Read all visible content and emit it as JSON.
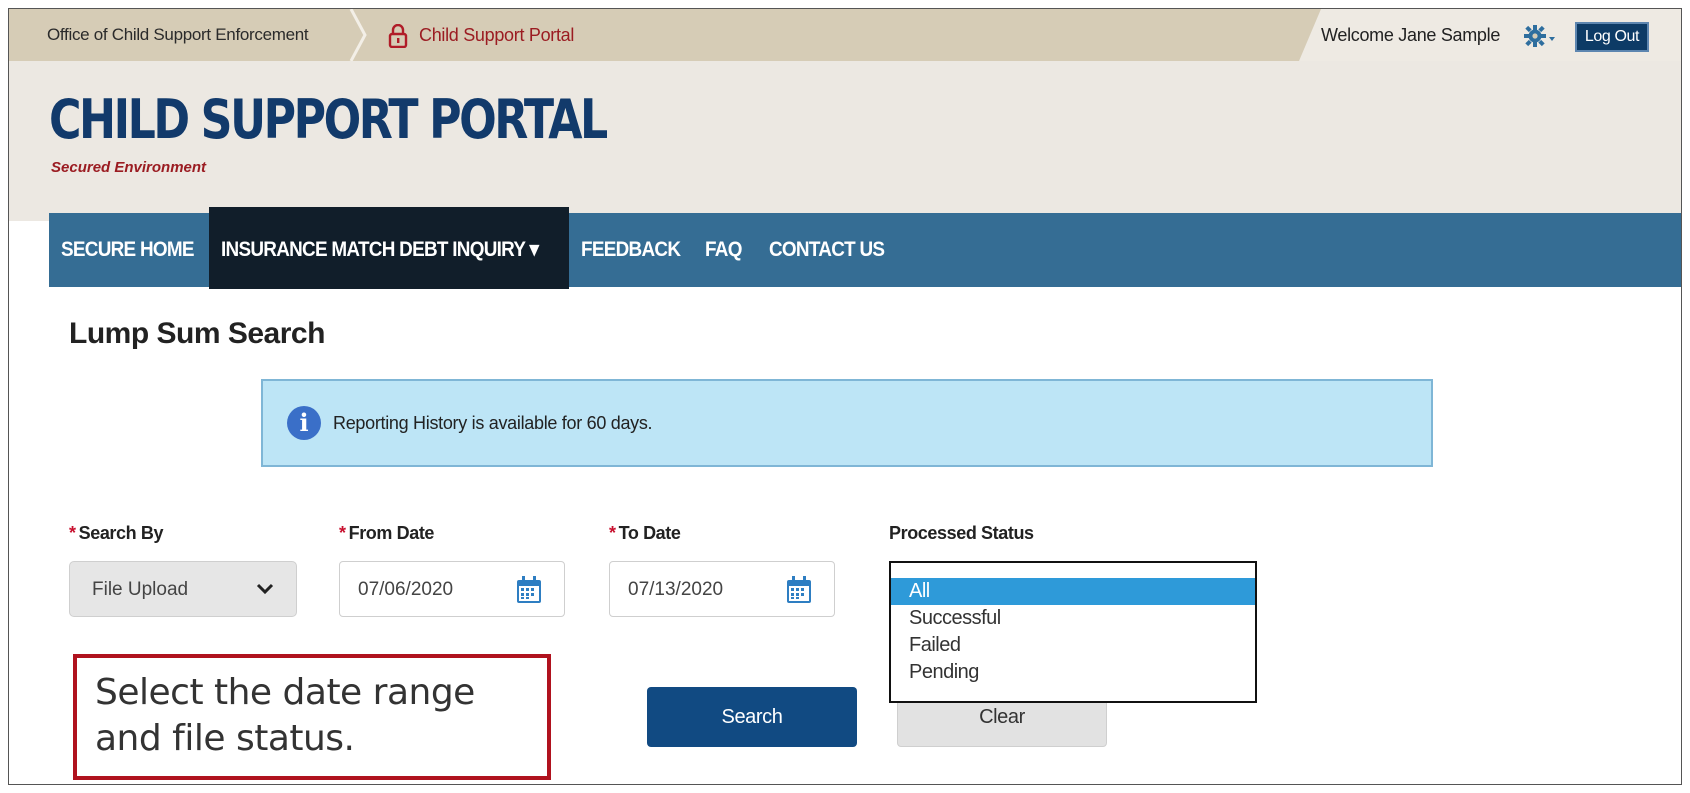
{
  "topbar": {
    "office_label": "Office of Child Support Enforcement",
    "portal_label": "Child Support Portal",
    "welcome_text": "Welcome Jane Sample",
    "logout_label": "Log Out"
  },
  "header": {
    "brand_title": "CHILD SUPPORT PORTAL",
    "brand_subtitle": "Secured Environment"
  },
  "nav": {
    "items": [
      {
        "label": "SECURE HOME"
      },
      {
        "label": "INSURANCE MATCH DEBT INQUIRY ▾"
      },
      {
        "label": "FEEDBACK"
      },
      {
        "label": "FAQ"
      },
      {
        "label": "CONTACT US"
      }
    ],
    "active_index": 1
  },
  "page": {
    "title": "Lump Sum Search",
    "info_text": "Reporting History is available for 60 days."
  },
  "form": {
    "search_by": {
      "label": "Search By",
      "required_mark": "*",
      "value": "File Upload"
    },
    "from_date": {
      "label": "From Date",
      "required_mark": "*",
      "value": "07/06/2020"
    },
    "to_date": {
      "label": "To Date",
      "required_mark": "*",
      "value": "07/13/2020"
    },
    "processed_status": {
      "label": "Processed Status",
      "options": [
        "All",
        "Successful",
        "Failed",
        "Pending"
      ],
      "selected": "All"
    },
    "search_label": "Search",
    "clear_label": "Clear"
  },
  "callout": {
    "text": "Select the date range and file status."
  },
  "colors": {
    "nav_bg": "#356d94",
    "nav_active_bg": "#111e2a",
    "brand_blue": "#123a6b",
    "accent_red": "#9b1c22",
    "info_bg": "#bde5f6",
    "search_button_bg": "#114a82",
    "listbox_selected_bg": "#2e9ad9"
  },
  "icons": [
    "lock-icon",
    "gear-icon",
    "info-icon",
    "chevron-down-icon",
    "calendar-icon"
  ]
}
